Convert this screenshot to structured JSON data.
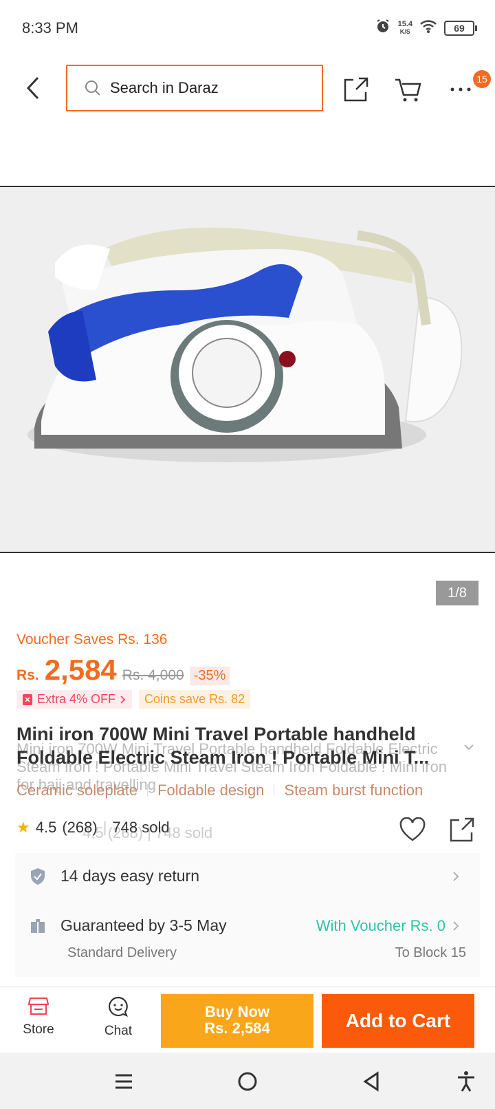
{
  "status_bar": {
    "time": "8:33 PM",
    "speed_value": "15.4",
    "speed_unit": "K/S",
    "battery": "69"
  },
  "header": {
    "search_placeholder": "Search in Daraz",
    "more_badge": "15",
    "accent_color": "#f36b21"
  },
  "gallery": {
    "counter": "1/8"
  },
  "product": {
    "voucher_saves": "Voucher Saves Rs. 136",
    "currency": "Rs.",
    "price": "2,584",
    "old_price": "Rs. 4,000",
    "discount": "-35%",
    "extra_off": "Extra 4% OFF",
    "coins_save": "Coins save Rs. 82",
    "title": "Mini iron 700W Mini Travel Portable handheld Foldable Electric Steam Iron ! Portable Mini T...",
    "title_full": "Mini iron 700W Mini Travel Portable handheld Foldable Electric Steam Iron ! Portable Mini Travel Steam Iron Foldable ! Mini iron for hajj and travelling",
    "features": [
      "Ceramic soleplate",
      "Foldable design",
      "Steam burst function"
    ],
    "rating": "4.5",
    "reviews": "(268)",
    "sold": "748 sold",
    "rating_ghost": "4.5 (268) | 748 sold"
  },
  "delivery": {
    "return_text": "14 days easy return",
    "guarantee_text": "Guaranteed by 3-5 May",
    "voucher_text": "With Voucher Rs. 0",
    "delivery_type": "Standard Delivery",
    "location": "To Block 15"
  },
  "bottom_bar": {
    "store_label": "Store",
    "chat_label": "Chat",
    "buy_now_label": "Buy Now",
    "buy_now_price": "Rs. 2,584",
    "add_to_cart_label": "Add to Cart"
  }
}
